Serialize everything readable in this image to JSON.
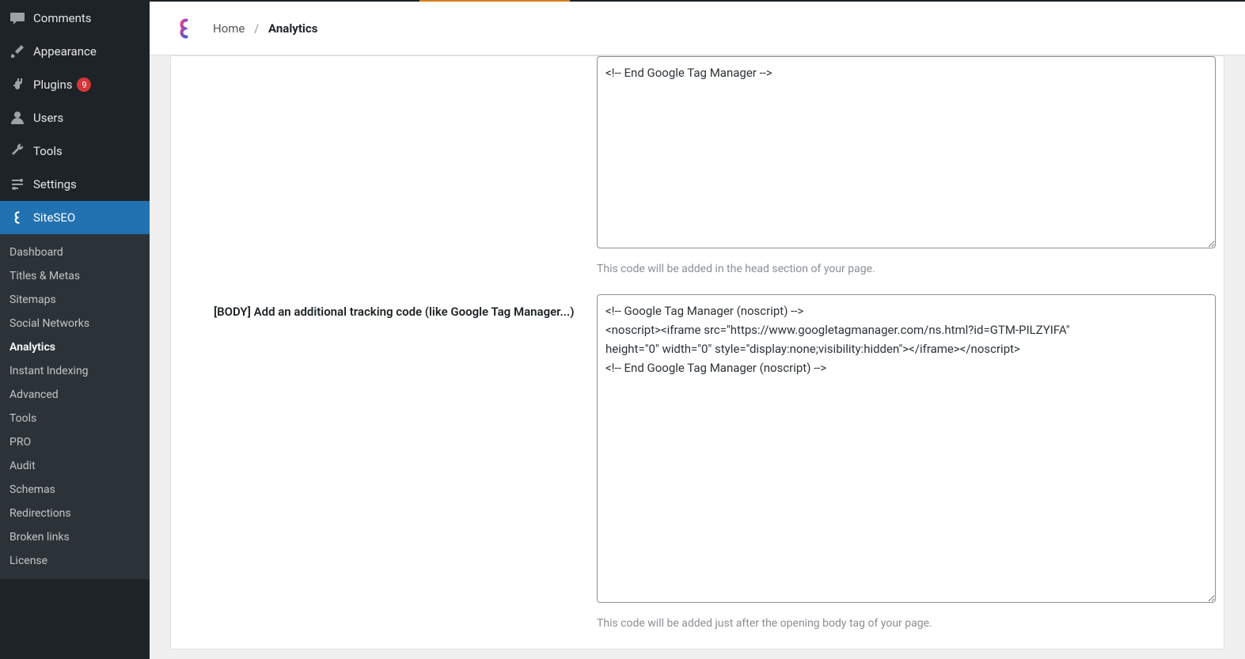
{
  "breadcrumb": {
    "home": "Home",
    "current": "Analytics"
  },
  "sidebar": {
    "main": [
      {
        "label": "Comments",
        "icon": "comment"
      },
      {
        "label": "Appearance",
        "icon": "brush"
      },
      {
        "label": "Plugins",
        "icon": "plug",
        "badge": "9"
      },
      {
        "label": "Users",
        "icon": "user"
      },
      {
        "label": "Tools",
        "icon": "wrench"
      },
      {
        "label": "Settings",
        "icon": "sliders"
      },
      {
        "label": "SiteSEO",
        "icon": "siteseo",
        "active": true
      }
    ],
    "sub": [
      {
        "label": "Dashboard"
      },
      {
        "label": "Titles & Metas"
      },
      {
        "label": "Sitemaps"
      },
      {
        "label": "Social Networks"
      },
      {
        "label": "Analytics",
        "current": true
      },
      {
        "label": "Instant Indexing"
      },
      {
        "label": "Advanced"
      },
      {
        "label": "Tools"
      },
      {
        "label": "PRO"
      },
      {
        "label": "Audit"
      },
      {
        "label": "Schemas"
      },
      {
        "label": "Redirections"
      },
      {
        "label": "Broken links"
      },
      {
        "label": "License"
      }
    ]
  },
  "fields": {
    "head": {
      "value": "<!-- End Google Tag Manager -->",
      "help": "This code will be added in the head section of your page."
    },
    "body": {
      "label": "[BODY] Add an additional tracking code (like Google Tag Manager...)",
      "value": "<!-- Google Tag Manager (noscript) -->\n<noscript><iframe src=\"https://www.googletagmanager.com/ns.html?id=GTM-PILZYIFA\"\nheight=\"0\" width=\"0\" style=\"display:none;visibility:hidden\"></iframe></noscript>\n<!-- End Google Tag Manager (noscript) -->",
      "help": "This code will be added just after the opening body tag of your page."
    }
  }
}
